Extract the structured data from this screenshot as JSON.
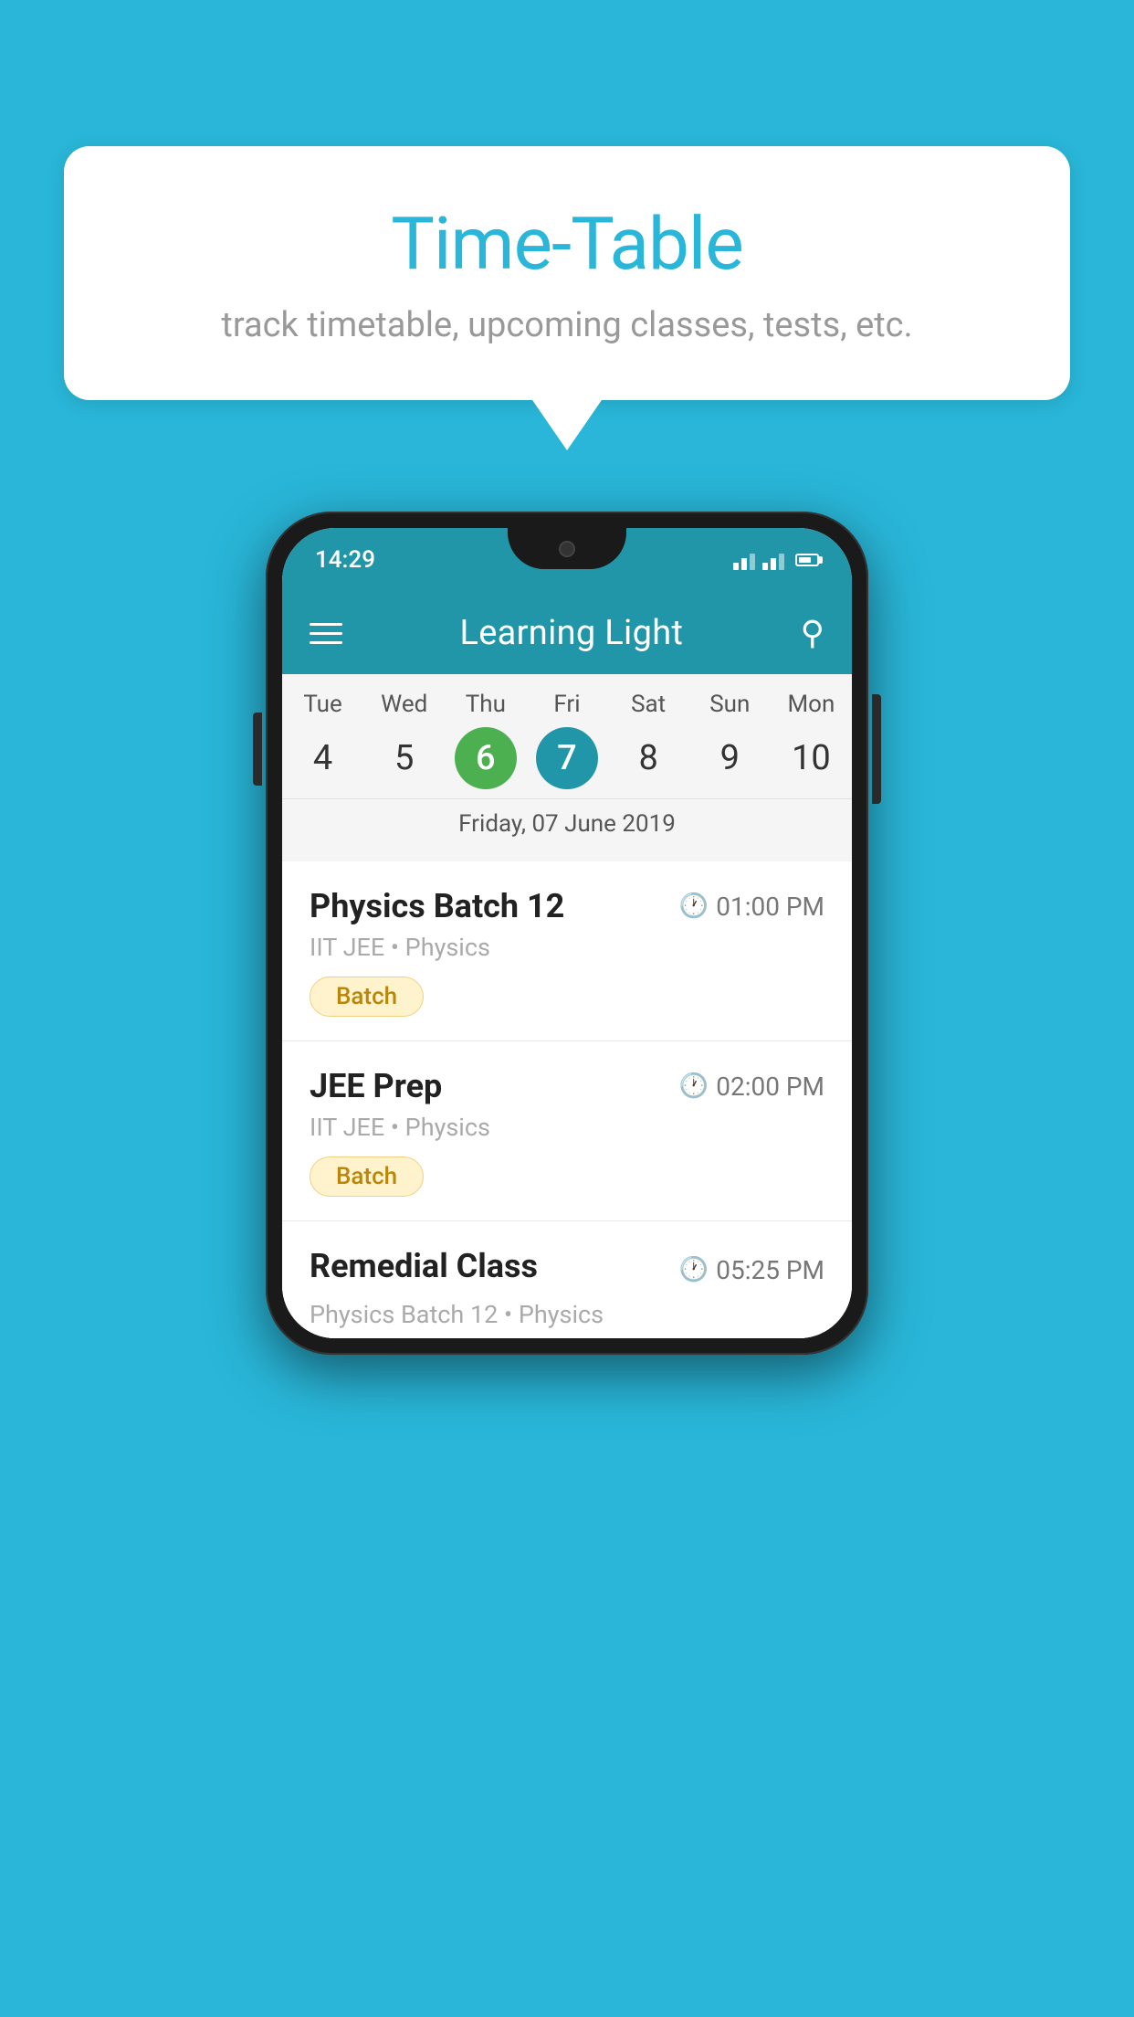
{
  "background_color": "#29b6d8",
  "speech_bubble": {
    "title": "Time-Table",
    "subtitle": "track timetable, upcoming classes, tests, etc."
  },
  "status_bar": {
    "time": "14:29"
  },
  "app_header": {
    "title": "Learning Light"
  },
  "calendar": {
    "days_of_week": [
      "Tue",
      "Wed",
      "Thu",
      "Fri",
      "Sat",
      "Sun",
      "Mon"
    ],
    "dates": [
      "4",
      "5",
      "6",
      "7",
      "8",
      "9",
      "10"
    ],
    "today_index": 2,
    "selected_index": 3,
    "selected_date_label": "Friday, 07 June 2019"
  },
  "schedule": {
    "items": [
      {
        "name": "Physics Batch 12",
        "time": "01:00 PM",
        "subtitle": "IIT JEE • Physics",
        "badge": "Batch"
      },
      {
        "name": "JEE Prep",
        "time": "02:00 PM",
        "subtitle": "IIT JEE • Physics",
        "badge": "Batch"
      },
      {
        "name": "Remedial Class",
        "time": "05:25 PM",
        "subtitle": "Physics Batch 12 • Physics",
        "badge": null
      }
    ]
  },
  "icons": {
    "search": "🔍",
    "clock": "🕐"
  }
}
